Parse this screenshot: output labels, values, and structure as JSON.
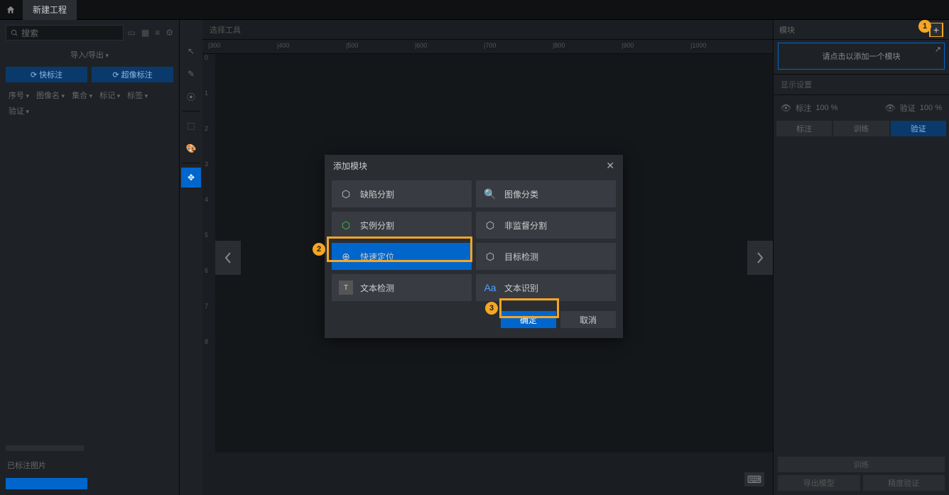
{
  "topbar": {
    "tab": "新建工程"
  },
  "left": {
    "search_placeholder": "搜索",
    "import": "导入/导出",
    "label_btn1": "⟳ 快标注",
    "label_btn2": "⟳ 超像标注",
    "filters": [
      "序号",
      "图像名",
      "集合",
      "标记",
      "标签",
      "验证"
    ],
    "labeled_header": "已标注图片"
  },
  "center": {
    "toolbar_title": "选择工具",
    "ruler_h": [
      "|300",
      "|400",
      "|500",
      "|600",
      "|700",
      "|800",
      "|900",
      "|1000"
    ],
    "ruler_v": [
      "0",
      "1",
      "2",
      "3",
      "4",
      "5",
      "6",
      "7",
      "8"
    ]
  },
  "right": {
    "header": "模块",
    "add_hint": "请点击以添加一个模块",
    "display_header": "显示设置",
    "vis1_label": "标注",
    "vis1_val": "100 %",
    "vis2_label": "验证",
    "vis2_val": "100 %",
    "tab1": "标注",
    "tab2": "训练",
    "tab3": "验证",
    "bottom1": "训练",
    "bottom2": "导出模型",
    "bottom3": "精度验证"
  },
  "modal": {
    "title": "添加模块",
    "options": [
      {
        "label": "缺陷分割",
        "icon": "⬡"
      },
      {
        "label": "图像分类",
        "icon": "🔍"
      },
      {
        "label": "实例分割",
        "icon": "⬡"
      },
      {
        "label": "非监督分割",
        "icon": "⬡"
      },
      {
        "label": "快速定位",
        "icon": "⊕"
      },
      {
        "label": "目标检测",
        "icon": "⬡"
      },
      {
        "label": "文本检测",
        "icon": "T"
      },
      {
        "label": "文本识别",
        "icon": "Aa"
      }
    ],
    "ok": "确定",
    "cancel": "取消"
  },
  "callouts": {
    "n1": "1",
    "n2": "2",
    "n3": "3"
  }
}
